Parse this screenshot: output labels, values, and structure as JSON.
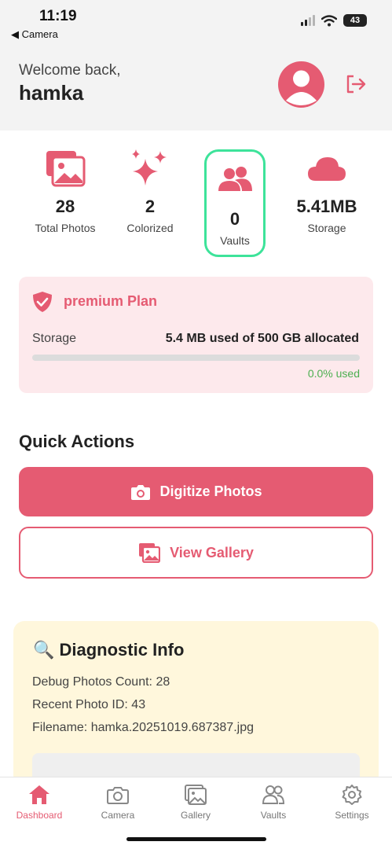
{
  "status_bar": {
    "time": "11:19",
    "back_label": "◀ Camera",
    "battery": "43"
  },
  "header": {
    "welcome": "Welcome back,",
    "username": "hamka"
  },
  "stats": [
    {
      "value": "28",
      "label": "Total Photos",
      "icon": "photos-icon"
    },
    {
      "value": "2",
      "label": "Colorized",
      "icon": "sparkles-icon"
    },
    {
      "value": "0",
      "label": "Vaults",
      "icon": "users-icon"
    },
    {
      "value": "5.41MB",
      "label": "Storage",
      "icon": "cloud-icon"
    }
  ],
  "plan": {
    "title": "premium Plan",
    "storage_label": "Storage",
    "storage_value": "5.4 MB used of 500 GB allocated",
    "used_percent_label": "0.0% used",
    "used_fraction": 0.0
  },
  "quick_actions": {
    "title": "Quick Actions",
    "digitize_label": "Digitize Photos",
    "gallery_label": "View Gallery"
  },
  "diagnostic": {
    "title": "🔍 Diagnostic Info",
    "lines": [
      "Debug Photos Count: 28",
      "Recent Photo ID: 43",
      "Filename: hamka.20251019.687387.jpg"
    ]
  },
  "tabs": [
    {
      "label": "Dashboard",
      "icon": "home-icon",
      "active": true
    },
    {
      "label": "Camera",
      "icon": "camera-icon",
      "active": false
    },
    {
      "label": "Gallery",
      "icon": "gallery-icon",
      "active": false
    },
    {
      "label": "Vaults",
      "icon": "users-icon",
      "active": false
    },
    {
      "label": "Settings",
      "icon": "gear-icon",
      "active": false
    }
  ],
  "colors": {
    "accent": "#e55b72",
    "vaults_highlight": "#3de39a",
    "success": "#4caf50",
    "plan_bg": "#fde9ec",
    "diag_bg": "#fff7dc"
  }
}
